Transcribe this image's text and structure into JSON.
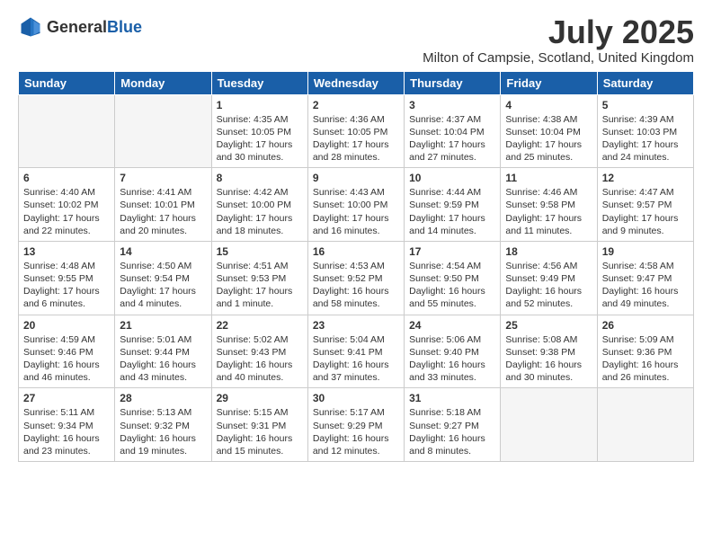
{
  "header": {
    "logo_general": "General",
    "logo_blue": "Blue",
    "title": "July 2025",
    "location": "Milton of Campsie, Scotland, United Kingdom"
  },
  "weekdays": [
    "Sunday",
    "Monday",
    "Tuesday",
    "Wednesday",
    "Thursday",
    "Friday",
    "Saturday"
  ],
  "weeks": [
    [
      {
        "day": "",
        "info": ""
      },
      {
        "day": "",
        "info": ""
      },
      {
        "day": "1",
        "info": "Sunrise: 4:35 AM\nSunset: 10:05 PM\nDaylight: 17 hours and 30 minutes."
      },
      {
        "day": "2",
        "info": "Sunrise: 4:36 AM\nSunset: 10:05 PM\nDaylight: 17 hours and 28 minutes."
      },
      {
        "day": "3",
        "info": "Sunrise: 4:37 AM\nSunset: 10:04 PM\nDaylight: 17 hours and 27 minutes."
      },
      {
        "day": "4",
        "info": "Sunrise: 4:38 AM\nSunset: 10:04 PM\nDaylight: 17 hours and 25 minutes."
      },
      {
        "day": "5",
        "info": "Sunrise: 4:39 AM\nSunset: 10:03 PM\nDaylight: 17 hours and 24 minutes."
      }
    ],
    [
      {
        "day": "6",
        "info": "Sunrise: 4:40 AM\nSunset: 10:02 PM\nDaylight: 17 hours and 22 minutes."
      },
      {
        "day": "7",
        "info": "Sunrise: 4:41 AM\nSunset: 10:01 PM\nDaylight: 17 hours and 20 minutes."
      },
      {
        "day": "8",
        "info": "Sunrise: 4:42 AM\nSunset: 10:00 PM\nDaylight: 17 hours and 18 minutes."
      },
      {
        "day": "9",
        "info": "Sunrise: 4:43 AM\nSunset: 10:00 PM\nDaylight: 17 hours and 16 minutes."
      },
      {
        "day": "10",
        "info": "Sunrise: 4:44 AM\nSunset: 9:59 PM\nDaylight: 17 hours and 14 minutes."
      },
      {
        "day": "11",
        "info": "Sunrise: 4:46 AM\nSunset: 9:58 PM\nDaylight: 17 hours and 11 minutes."
      },
      {
        "day": "12",
        "info": "Sunrise: 4:47 AM\nSunset: 9:57 PM\nDaylight: 17 hours and 9 minutes."
      }
    ],
    [
      {
        "day": "13",
        "info": "Sunrise: 4:48 AM\nSunset: 9:55 PM\nDaylight: 17 hours and 6 minutes."
      },
      {
        "day": "14",
        "info": "Sunrise: 4:50 AM\nSunset: 9:54 PM\nDaylight: 17 hours and 4 minutes."
      },
      {
        "day": "15",
        "info": "Sunrise: 4:51 AM\nSunset: 9:53 PM\nDaylight: 17 hours and 1 minute."
      },
      {
        "day": "16",
        "info": "Sunrise: 4:53 AM\nSunset: 9:52 PM\nDaylight: 16 hours and 58 minutes."
      },
      {
        "day": "17",
        "info": "Sunrise: 4:54 AM\nSunset: 9:50 PM\nDaylight: 16 hours and 55 minutes."
      },
      {
        "day": "18",
        "info": "Sunrise: 4:56 AM\nSunset: 9:49 PM\nDaylight: 16 hours and 52 minutes."
      },
      {
        "day": "19",
        "info": "Sunrise: 4:58 AM\nSunset: 9:47 PM\nDaylight: 16 hours and 49 minutes."
      }
    ],
    [
      {
        "day": "20",
        "info": "Sunrise: 4:59 AM\nSunset: 9:46 PM\nDaylight: 16 hours and 46 minutes."
      },
      {
        "day": "21",
        "info": "Sunrise: 5:01 AM\nSunset: 9:44 PM\nDaylight: 16 hours and 43 minutes."
      },
      {
        "day": "22",
        "info": "Sunrise: 5:02 AM\nSunset: 9:43 PM\nDaylight: 16 hours and 40 minutes."
      },
      {
        "day": "23",
        "info": "Sunrise: 5:04 AM\nSunset: 9:41 PM\nDaylight: 16 hours and 37 minutes."
      },
      {
        "day": "24",
        "info": "Sunrise: 5:06 AM\nSunset: 9:40 PM\nDaylight: 16 hours and 33 minutes."
      },
      {
        "day": "25",
        "info": "Sunrise: 5:08 AM\nSunset: 9:38 PM\nDaylight: 16 hours and 30 minutes."
      },
      {
        "day": "26",
        "info": "Sunrise: 5:09 AM\nSunset: 9:36 PM\nDaylight: 16 hours and 26 minutes."
      }
    ],
    [
      {
        "day": "27",
        "info": "Sunrise: 5:11 AM\nSunset: 9:34 PM\nDaylight: 16 hours and 23 minutes."
      },
      {
        "day": "28",
        "info": "Sunrise: 5:13 AM\nSunset: 9:32 PM\nDaylight: 16 hours and 19 minutes."
      },
      {
        "day": "29",
        "info": "Sunrise: 5:15 AM\nSunset: 9:31 PM\nDaylight: 16 hours and 15 minutes."
      },
      {
        "day": "30",
        "info": "Sunrise: 5:17 AM\nSunset: 9:29 PM\nDaylight: 16 hours and 12 minutes."
      },
      {
        "day": "31",
        "info": "Sunrise: 5:18 AM\nSunset: 9:27 PM\nDaylight: 16 hours and 8 minutes."
      },
      {
        "day": "",
        "info": ""
      },
      {
        "day": "",
        "info": ""
      }
    ]
  ]
}
